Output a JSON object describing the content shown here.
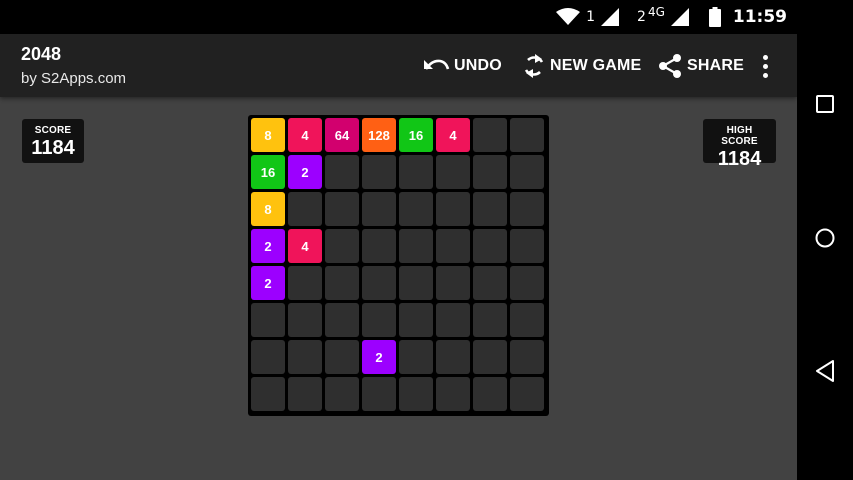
{
  "status_bar": {
    "sim1_label": "1",
    "sim2_label": "2",
    "network_type": "4G",
    "time": "11:59",
    "icons": [
      "wifi-icon",
      "signal-icon",
      "signal-icon",
      "battery-icon"
    ]
  },
  "app_bar": {
    "title": "2048",
    "subtitle": "by S2Apps.com",
    "undo_label": "UNDO",
    "new_game_label": "NEW GAME",
    "share_label": "SHARE",
    "icons": [
      "undo-icon",
      "refresh-icon",
      "share-icon",
      "overflow-menu-icon"
    ]
  },
  "scores": {
    "score_label": "SCORE",
    "score_value": "1184",
    "high_score_label": "HIGH SCORE",
    "high_score_value": "1184"
  },
  "board": {
    "rows": 8,
    "cols": 8,
    "tile_colors": {
      "2": "#9c00ff",
      "4": "#f0145a",
      "8": "#ffc20e",
      "16": "#11c616",
      "64": "#d2006e",
      "128": "#ff6014"
    },
    "empty_color": "#2f2f2f",
    "grid": [
      [
        "8",
        "4",
        "64",
        "128",
        "16",
        "4",
        "",
        ""
      ],
      [
        "16",
        "2",
        "",
        "",
        "",
        "",
        "",
        ""
      ],
      [
        "8",
        "",
        "",
        "",
        "",
        "",
        "",
        ""
      ],
      [
        "2",
        "4",
        "",
        "",
        "",
        "",
        "",
        ""
      ],
      [
        "2",
        "",
        "",
        "",
        "",
        "",
        "",
        ""
      ],
      [
        "",
        "",
        "",
        "",
        "",
        "",
        "",
        ""
      ],
      [
        "",
        "",
        "",
        "2",
        "",
        "",
        "",
        ""
      ],
      [
        "",
        "",
        "",
        "",
        "",
        "",
        "",
        ""
      ]
    ]
  },
  "nav_bar": {
    "icons": [
      "recents-icon",
      "home-icon",
      "back-icon"
    ]
  },
  "colors": {
    "background": "#424242",
    "app_bar": "#212121",
    "status_bar": "#000000",
    "board": "#000000"
  }
}
